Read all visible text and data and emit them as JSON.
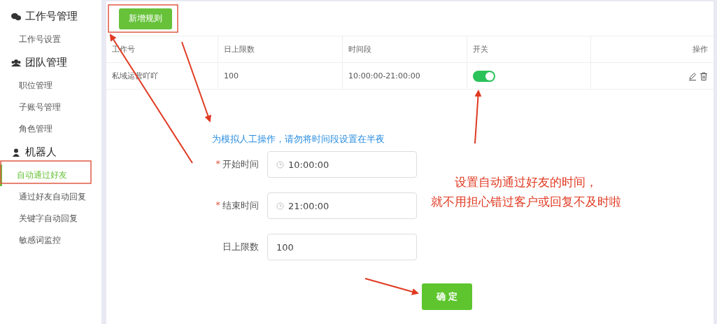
{
  "sidebar": {
    "groups": [
      {
        "title": "工作号管理",
        "items": [
          {
            "label": "工作号设置",
            "selected": false
          }
        ]
      },
      {
        "title": "团队管理",
        "items": [
          {
            "label": "职位管理",
            "selected": false
          },
          {
            "label": "子账号管理",
            "selected": false
          },
          {
            "label": "角色管理",
            "selected": false
          }
        ]
      },
      {
        "title": "机器人",
        "items": [
          {
            "label": "自动通过好友",
            "selected": true
          },
          {
            "label": "通过好友自动回复",
            "selected": false
          },
          {
            "label": "关键字自动回复",
            "selected": false
          },
          {
            "label": "敏感词监控",
            "selected": false
          }
        ]
      }
    ]
  },
  "add_button": "新增规则",
  "table": {
    "columns": [
      "工作号",
      "日上限数",
      "时间段",
      "开关",
      "操作"
    ],
    "rows": [
      {
        "account": "私域运营吖吖",
        "limit": "100",
        "period": "10:00:00-21:00:00",
        "on": true
      }
    ]
  },
  "form": {
    "notice": "为模拟人工操作，请勿将时间段设置在半夜",
    "fields": [
      {
        "kind": "time",
        "label": "开始时间",
        "required": true,
        "value": "10:00:00"
      },
      {
        "kind": "time",
        "label": "结束时间",
        "required": true,
        "value": "21:00:00"
      },
      {
        "kind": "text",
        "label": "日上限数",
        "required": false,
        "value": "100"
      }
    ],
    "confirm": "确 定",
    "required_mark": "*"
  },
  "annotation": {
    "lines": [
      "设置自动通过好友的时间，",
      "就不用担心错过客户或回复不及时啦"
    ]
  }
}
